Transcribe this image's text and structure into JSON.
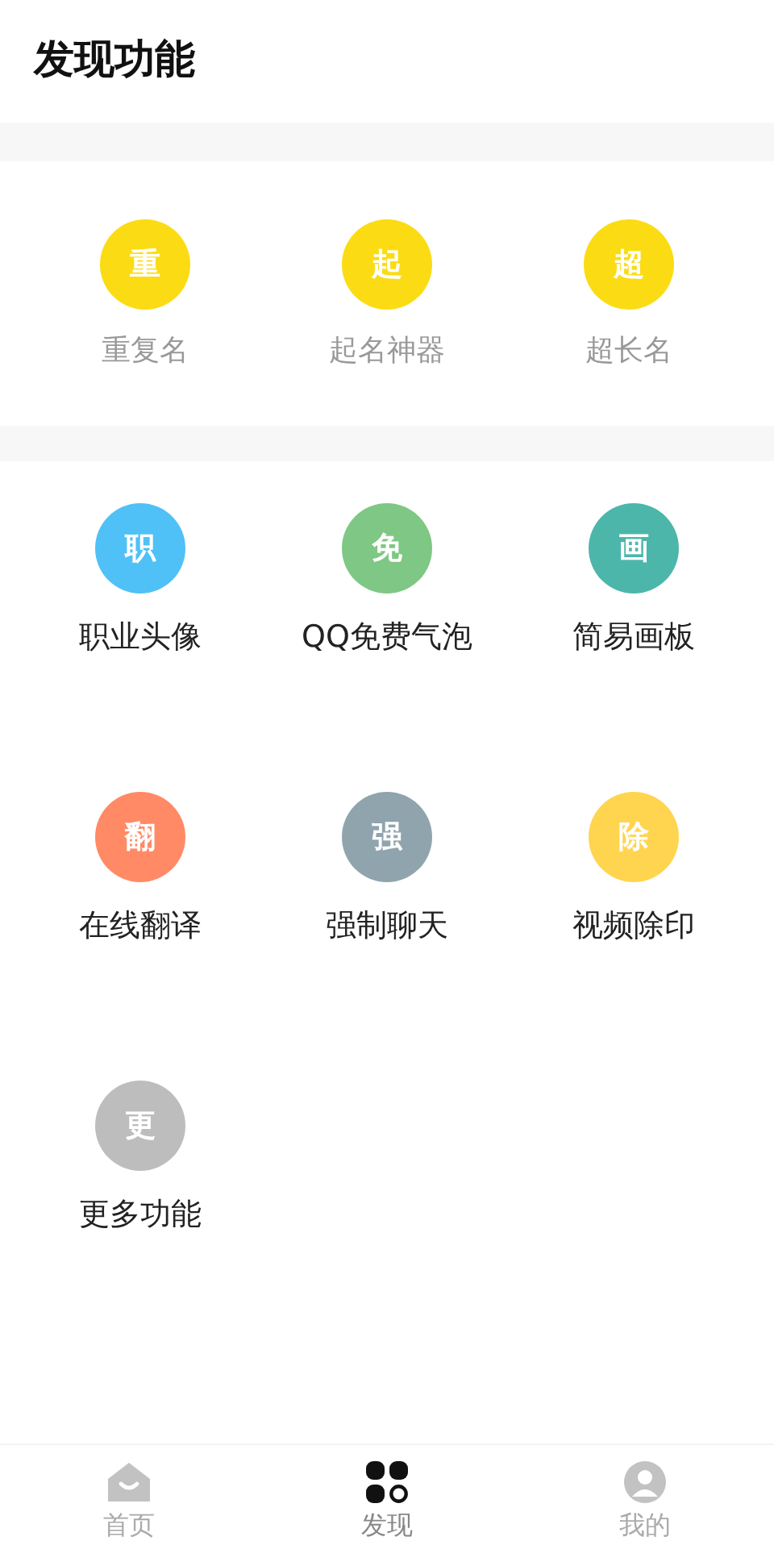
{
  "title": "发现功能",
  "featured": [
    {
      "glyph": "重",
      "label": "重复名",
      "color": "#fbdc14"
    },
    {
      "glyph": "起",
      "label": "起名神器",
      "color": "#fbdc14"
    },
    {
      "glyph": "超",
      "label": "超长名",
      "color": "#fbdc14"
    }
  ],
  "tools": [
    {
      "glyph": "职",
      "label": "职业头像",
      "color": "#4fc1f6"
    },
    {
      "glyph": "免",
      "label": "QQ免费气泡",
      "color": "#7fc784"
    },
    {
      "glyph": "画",
      "label": "简易画板",
      "color": "#4db6ab"
    },
    {
      "glyph": "翻",
      "label": "在线翻译",
      "color": "#ff8a65"
    },
    {
      "glyph": "强",
      "label": "强制聊天",
      "color": "#90a4ae"
    },
    {
      "glyph": "除",
      "label": "视频除印",
      "color": "#ffd54f"
    },
    {
      "glyph": "更",
      "label": "更多功能",
      "color": "#bdbdbd"
    }
  ],
  "nav": [
    {
      "kind": "home",
      "label": "首页",
      "selected": false
    },
    {
      "kind": "discover",
      "label": "发现",
      "selected": true
    },
    {
      "kind": "profile",
      "label": "我的",
      "selected": false
    }
  ]
}
